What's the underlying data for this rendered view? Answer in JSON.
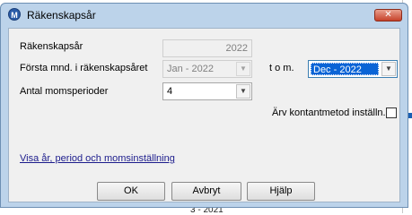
{
  "background": {
    "partial_text": "3 - 2021"
  },
  "dialog": {
    "title": "Räkenskapsår",
    "close_symbol": "✕"
  },
  "form": {
    "year_label": "Räkenskapsår",
    "year_value": "2022",
    "first_month_label": "Första mnd. i räkenskapsåret",
    "first_month_value": "Jan - 2022",
    "to_label": "t o m.",
    "last_month_value": "Dec - 2022",
    "vat_periods_label": "Antal momsperioder",
    "vat_periods_value": "4",
    "inherit_cash_label": "Ärv kontantmetod inställn.",
    "inherit_cash_checked": false,
    "show_link": "Visa år, period och momsinställning"
  },
  "buttons": {
    "ok": "OK",
    "cancel": "Avbryt",
    "help": "Hjälp"
  },
  "colors": {
    "frame": "#bcd3ea",
    "client": "#f0f0f0",
    "selection": "#0a64d6",
    "close": "#c6412a",
    "link": "#1c1c8c"
  },
  "icons": {
    "app": "app-logo-icon",
    "dropdown": "chevron-down-icon",
    "close": "close-icon"
  }
}
